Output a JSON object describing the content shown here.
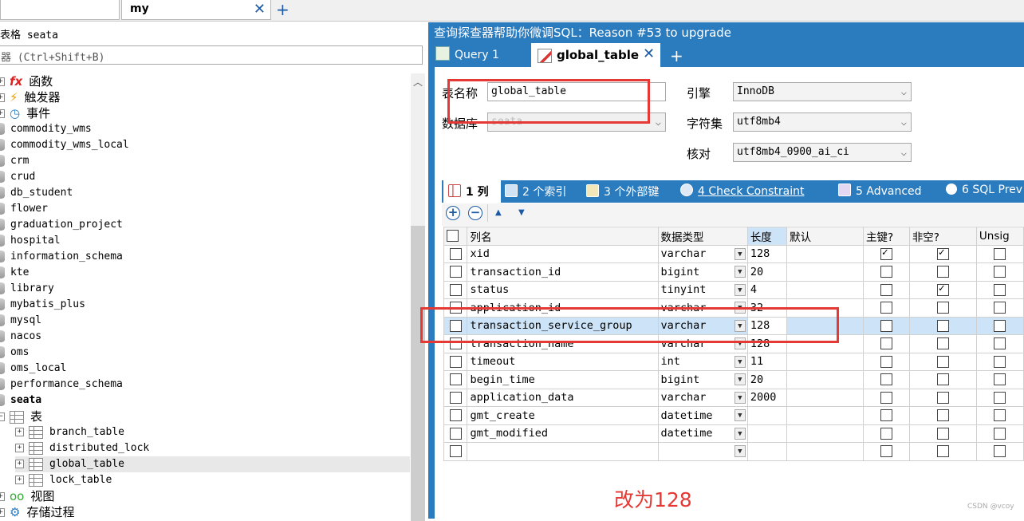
{
  "tabs": {
    "active": "my"
  },
  "left": {
    "title": "表格 seata",
    "filter_placeholder": "器 (Ctrl+Shift+B)",
    "tree": [
      {
        "label": "函数",
        "kind": "folder",
        "icon": "function-icon"
      },
      {
        "label": "触发器",
        "kind": "folder",
        "icon": "trigger-icon"
      },
      {
        "label": "事件",
        "kind": "folder",
        "icon": "event-icon"
      },
      {
        "label": "commodity_wms",
        "kind": "db"
      },
      {
        "label": "commodity_wms_local",
        "kind": "db"
      },
      {
        "label": "crm",
        "kind": "db"
      },
      {
        "label": "crud",
        "kind": "db"
      },
      {
        "label": "db_student",
        "kind": "db"
      },
      {
        "label": "flower",
        "kind": "db"
      },
      {
        "label": "graduation_project",
        "kind": "db"
      },
      {
        "label": "hospital",
        "kind": "db"
      },
      {
        "label": "information_schema",
        "kind": "db"
      },
      {
        "label": "kte",
        "kind": "db"
      },
      {
        "label": "library",
        "kind": "db"
      },
      {
        "label": "mybatis_plus",
        "kind": "db"
      },
      {
        "label": "mysql",
        "kind": "db"
      },
      {
        "label": "nacos",
        "kind": "db"
      },
      {
        "label": "oms",
        "kind": "db"
      },
      {
        "label": "oms_local",
        "kind": "db"
      },
      {
        "label": "performance_schema",
        "kind": "db"
      },
      {
        "label": "seata",
        "kind": "db",
        "bold": true
      },
      {
        "label": "表",
        "kind": "folder",
        "icon": "table-folder-icon"
      },
      {
        "label": "branch_table",
        "kind": "table"
      },
      {
        "label": "distributed_lock",
        "kind": "table"
      },
      {
        "label": "global_table",
        "kind": "table",
        "selected": true
      },
      {
        "label": "lock_table",
        "kind": "table"
      },
      {
        "label": "视图",
        "kind": "folder",
        "icon": "view-icon"
      },
      {
        "label": "存储过程",
        "kind": "folder",
        "icon": "procedure-icon"
      }
    ]
  },
  "right": {
    "title": "查询探查器帮助你微调SQL：Reason #53 to upgrade",
    "query_tab": "Query 1",
    "active_tab": "global_table",
    "form": {
      "table_name_label": "表名称",
      "table_name": "global_table",
      "database_label": "数据库",
      "database": "seata",
      "engine_label": "引擎",
      "engine": "InnoDB",
      "charset_label": "字符集",
      "charset": "utf8mb4",
      "collation_label": "核对",
      "collation": "utf8mb4_0900_ai_ci"
    },
    "subtabs": [
      "1 列",
      "2 个索引",
      "3 个外部键",
      "4 Check Constraint",
      "5 Advanced",
      "6 SQL Prev"
    ],
    "columns_header": {
      "name": "列名",
      "type": "数据类型",
      "length": "长度",
      "default": "默认",
      "pk": "主键?",
      "notnull": "非空?",
      "unsigned": "Unsig"
    },
    "rows": [
      {
        "name": "xid",
        "type": "varchar",
        "length": "128",
        "pk": true,
        "nn": true
      },
      {
        "name": "transaction_id",
        "type": "bigint",
        "length": "20",
        "pk": false,
        "nn": false
      },
      {
        "name": "status",
        "type": "tinyint",
        "length": "4",
        "pk": false,
        "nn": true
      },
      {
        "name": "application_id",
        "type": "varchar",
        "length": "32",
        "pk": false,
        "nn": false
      },
      {
        "name": "transaction_service_group",
        "type": "varchar",
        "length": "128",
        "pk": false,
        "nn": false,
        "selected": true
      },
      {
        "name": "transaction_name",
        "type": "varchar",
        "length": "128",
        "pk": false,
        "nn": false
      },
      {
        "name": "timeout",
        "type": "int",
        "length": "11",
        "pk": false,
        "nn": false
      },
      {
        "name": "begin_time",
        "type": "bigint",
        "length": "20",
        "pk": false,
        "nn": false
      },
      {
        "name": "application_data",
        "type": "varchar",
        "length": "2000",
        "pk": false,
        "nn": false
      },
      {
        "name": "gmt_create",
        "type": "datetime",
        "length": "",
        "pk": false,
        "nn": false
      },
      {
        "name": "gmt_modified",
        "type": "datetime",
        "length": "",
        "pk": false,
        "nn": false
      },
      {
        "name": "",
        "type": "",
        "length": "",
        "pk": false,
        "nn": false
      }
    ],
    "annotation": "改为128",
    "watermark": "CSDN @vcoy"
  }
}
